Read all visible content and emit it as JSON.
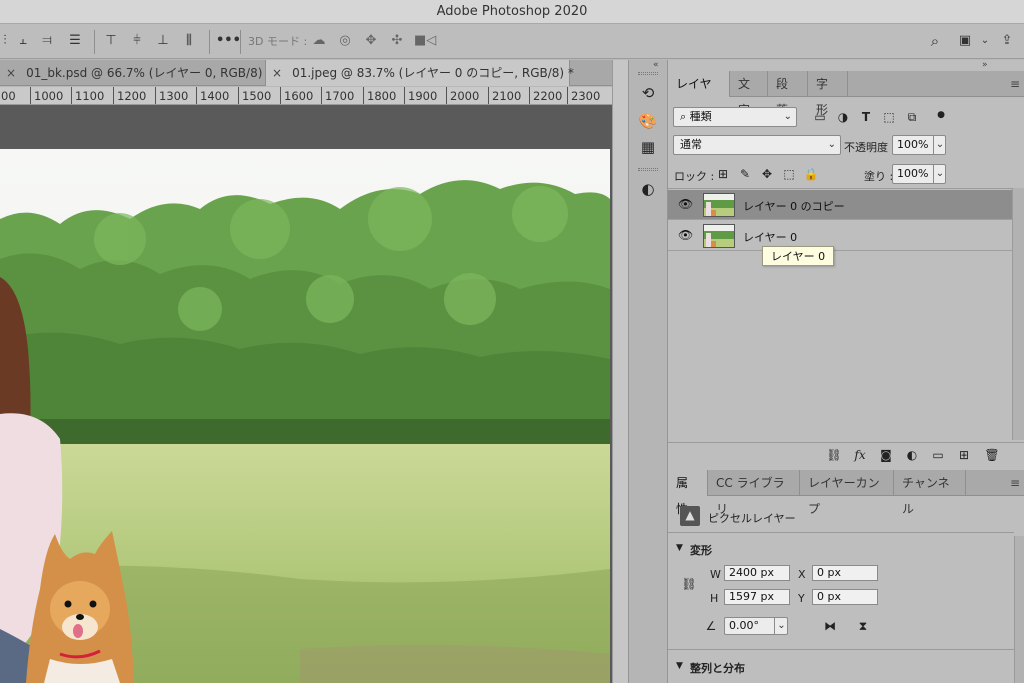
{
  "window": {
    "title": "Adobe Photoshop 2020"
  },
  "options_bar": {
    "mode_3d_label": "3D モード :",
    "more_label": "•••"
  },
  "doc_tabs": [
    {
      "label": "01_bk.psd @ 66.7% (レイヤー 0, RGB/8) *",
      "active": false
    },
    {
      "label": "01.jpeg @ 83.7% (レイヤー 0 のコピー, RGB/8) *",
      "active": true
    }
  ],
  "ruler": {
    "ticks": [
      "00",
      "1000",
      "1100",
      "1200",
      "1300",
      "1400",
      "1500",
      "1600",
      "1700",
      "1800",
      "1900",
      "2000",
      "2100",
      "2200",
      "2300"
    ]
  },
  "layers_panel": {
    "tabs": [
      "レイヤー",
      "文字",
      "段落",
      "字形"
    ],
    "filter_label": "種類",
    "blend_mode": "通常",
    "opacity_label": "不透明度 :",
    "opacity_value": "100%",
    "lock_label": "ロック :",
    "fill_label": "塗り :",
    "fill_value": "100%",
    "layers": [
      {
        "name": "レイヤー 0 のコピー",
        "selected": true
      },
      {
        "name": "レイヤー 0",
        "selected": false
      }
    ],
    "tooltip": "レイヤー 0",
    "footer_fx": "fx"
  },
  "properties_panel": {
    "tabs": [
      "属性",
      "CC ライブラリ",
      "レイヤーカンプ",
      "チャンネル"
    ],
    "layer_type": "ピクセルレイヤー",
    "transform_title": "変形",
    "w_label": "W",
    "w_value": "2400 px",
    "h_label": "H",
    "h_value": "1597 px",
    "x_label": "X",
    "x_value": "0 px",
    "y_label": "Y",
    "y_value": "0 px",
    "angle_value": "0.00°",
    "align_title": "整列と分布"
  },
  "colors": {
    "sky": "#f4f5f3",
    "trees": "#5f9a45",
    "grass": "#b8cc7e",
    "selected_layer": "#8d8d8d",
    "tooltip_bg": "#fffde0"
  }
}
